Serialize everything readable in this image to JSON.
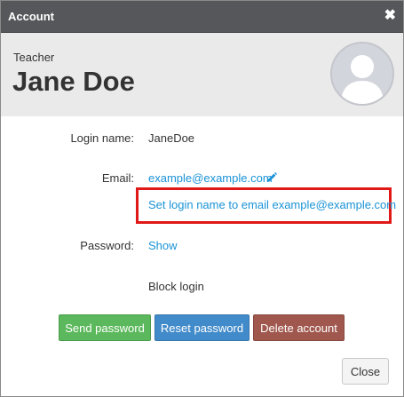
{
  "dialog": {
    "title": "Account",
    "close_icon": "close-x-icon"
  },
  "header": {
    "role": "Teacher",
    "name": "Jane Doe",
    "avatar_icon": "user-silhouette-icon"
  },
  "fields": {
    "login_label": "Login name:",
    "login_value": "JaneDoe",
    "email_label": "Email:",
    "email_value": "example@example.com",
    "email_edit_icon": "pencil-icon",
    "set_login_link": "Set login name to email example@example.com",
    "password_label": "Password:",
    "password_link": "Show",
    "block_login": "Block login"
  },
  "buttons": {
    "send_password": "Send password",
    "reset_password": "Reset password",
    "delete_account": "Delete account",
    "close": "Close"
  },
  "colors": {
    "titlebar": "#55575a",
    "link": "#1a93d6",
    "highlight": "#e01818",
    "send": "#5cb85c",
    "reset": "#428bca",
    "delete": "#a0584e"
  }
}
